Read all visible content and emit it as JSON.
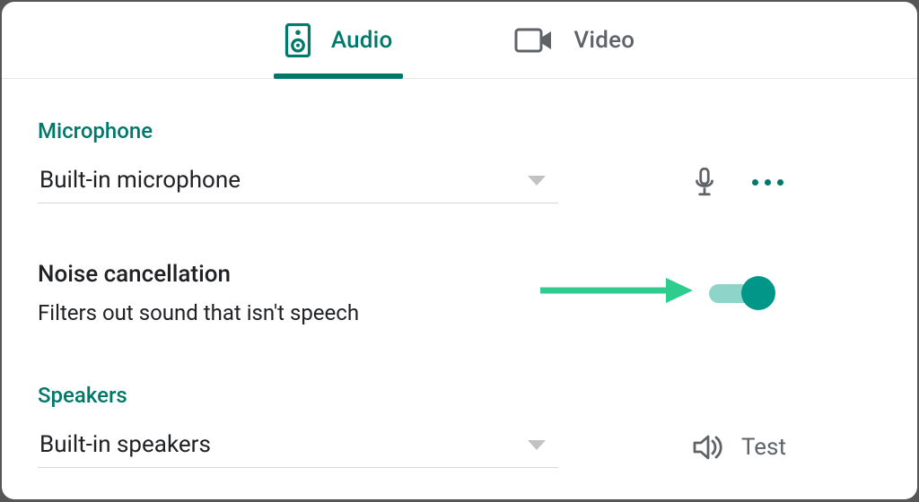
{
  "tabs": {
    "audio": {
      "label": "Audio",
      "active": true
    },
    "video": {
      "label": "Video",
      "active": false
    }
  },
  "microphone": {
    "title": "Microphone",
    "selected": "Built-in microphone"
  },
  "noise": {
    "title": "Noise cancellation",
    "description": "Filters out sound that isn't speech",
    "enabled": true
  },
  "speakers": {
    "title": "Speakers",
    "selected": "Built-in speakers",
    "test_label": "Test"
  },
  "colors": {
    "accent": "#00796b",
    "toggle_thumb": "#009688",
    "annotation_arrow": "#2ecc8f"
  }
}
